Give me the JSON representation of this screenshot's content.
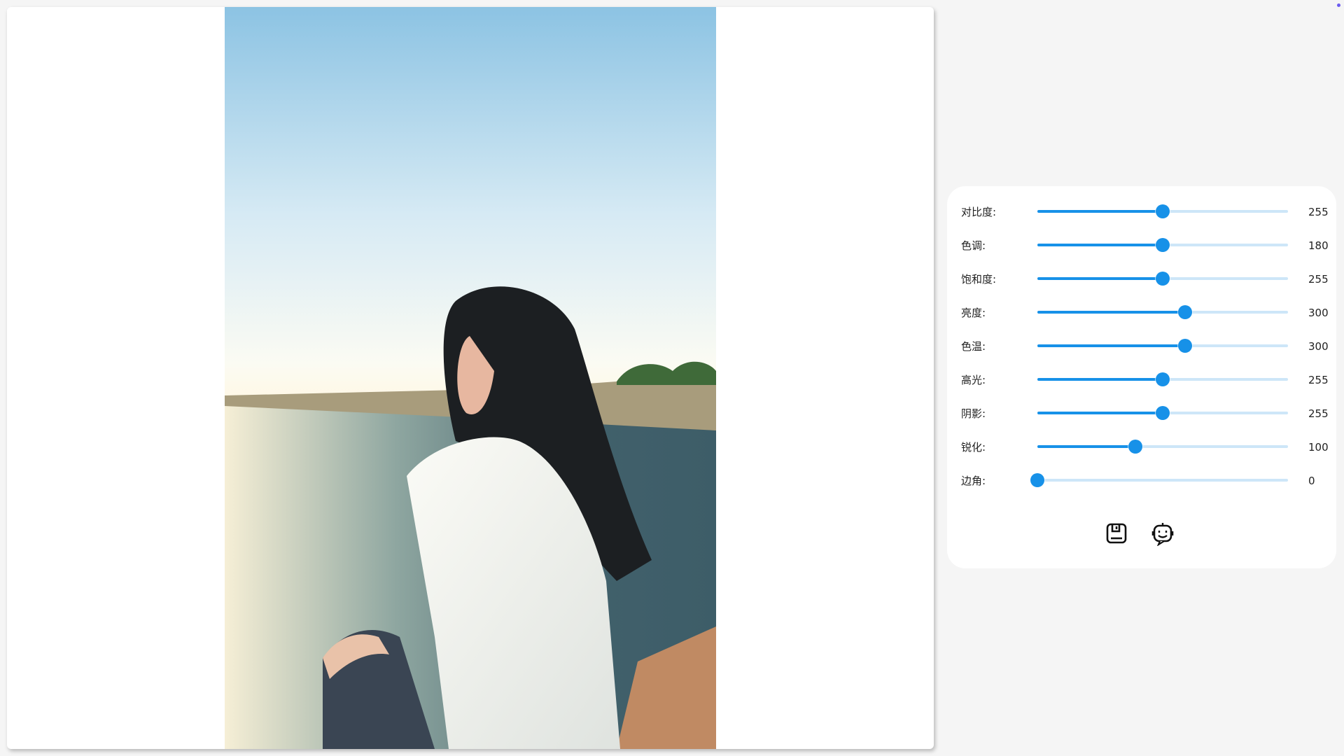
{
  "editor": {
    "sliders": [
      {
        "label": "对比度:",
        "value": "255",
        "level": 0.5
      },
      {
        "label": "色调:",
        "value": "180",
        "level": 0.5
      },
      {
        "label": "饱和度:",
        "value": "255",
        "level": 0.5
      },
      {
        "label": "亮度:",
        "value": "300",
        "level": 0.588
      },
      {
        "label": "色温:",
        "value": "300",
        "level": 0.588
      },
      {
        "label": "高光:",
        "value": "255",
        "level": 0.5
      },
      {
        "label": "阴影:",
        "value": "255",
        "level": 0.5
      },
      {
        "label": "锐化:",
        "value": "100",
        "level": 0.392
      },
      {
        "label": "边角:",
        "value": "0",
        "level": 0.0
      }
    ],
    "actions": {
      "save_icon": "save-icon",
      "auto_icon": "robot-icon"
    }
  },
  "colors": {
    "accent": "#1791e8",
    "track": "#cde6f8",
    "background": "#f5f5f5"
  }
}
